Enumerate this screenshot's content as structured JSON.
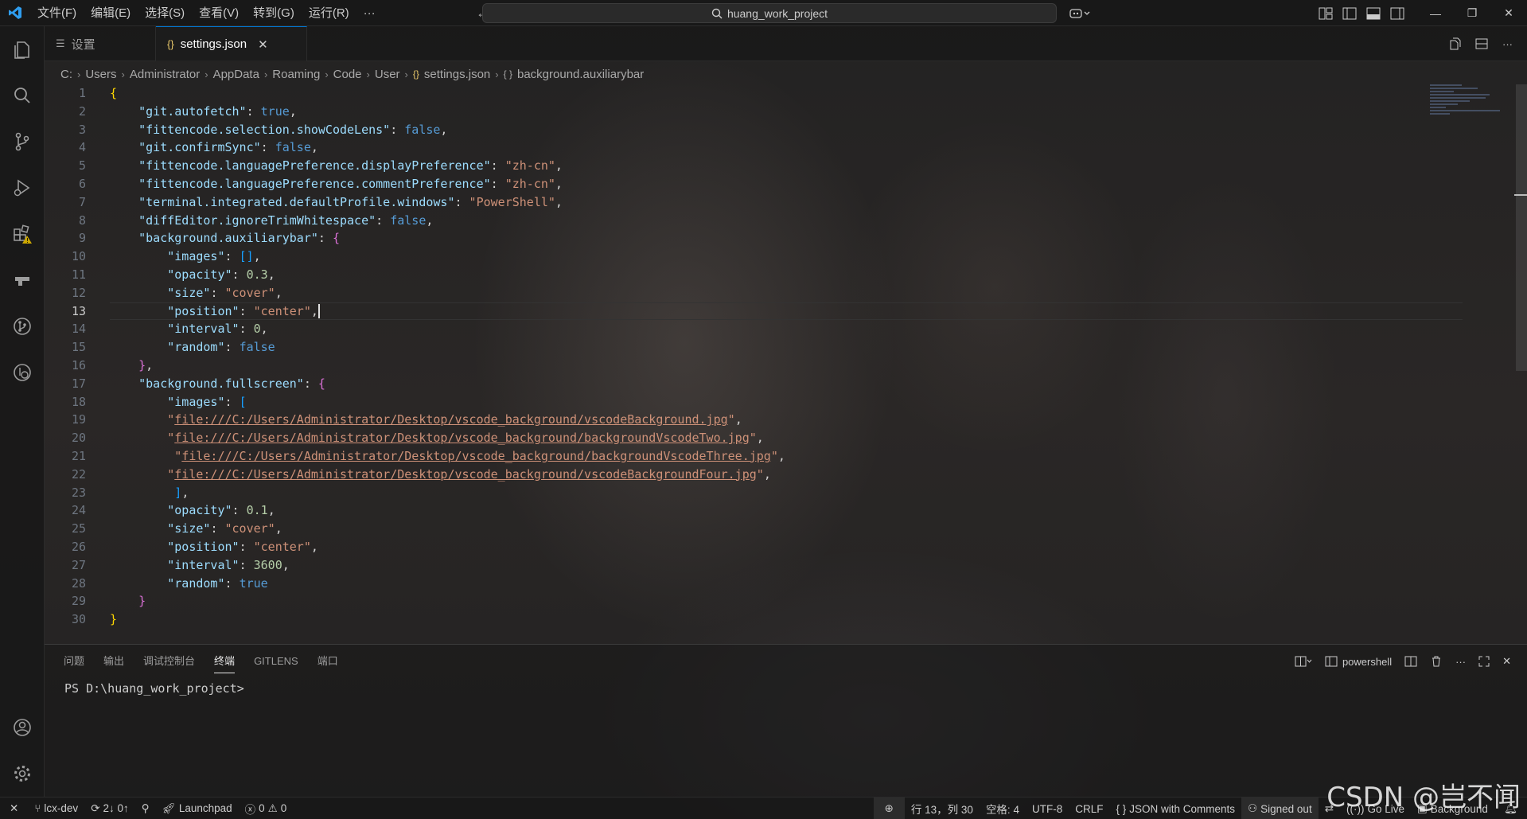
{
  "colors": {
    "accent": "#0078d4",
    "key": "#9cdcfe",
    "string": "#ce9178",
    "boolean": "#569cd6",
    "number": "#b5cea8",
    "warning": "#cca700"
  },
  "titlebar": {
    "menus": [
      "文件(F)",
      "编辑(E)",
      "选择(S)",
      "查看(V)",
      "转到(G)",
      "运行(R)",
      "···"
    ],
    "search_text": "huang_work_project"
  },
  "tabs": [
    {
      "label": "设置",
      "icon": "settings-lines-icon"
    },
    {
      "label": "settings.json",
      "icon": "json-braces-icon"
    }
  ],
  "breadcrumb": [
    "C:",
    "Users",
    "Administrator",
    "AppData",
    "Roaming",
    "Code",
    "User",
    "settings.json",
    "background.auxiliarybar"
  ],
  "editor": {
    "current_line": 13,
    "line_numbers": [
      "1",
      "2",
      "3",
      "4",
      "5",
      "6",
      "7",
      "8",
      "9",
      "10",
      "11",
      "12",
      "13",
      "14",
      "15",
      "16",
      "17",
      "18",
      "19",
      "20",
      "21",
      "22",
      "23",
      "24",
      "25",
      "26",
      "27",
      "28",
      "29",
      "30"
    ],
    "lines": [
      {
        "i": "",
        "t": [
          {
            "c": "p1",
            "v": "{"
          }
        ]
      },
      {
        "i": "    ",
        "t": [
          {
            "c": "k",
            "v": "\"git.autofetch\""
          },
          {
            "c": "",
            "v": ": "
          },
          {
            "c": "b",
            "v": "true"
          },
          {
            "c": "",
            "v": ","
          }
        ]
      },
      {
        "i": "    ",
        "t": [
          {
            "c": "k",
            "v": "\"fittencode.selection.showCodeLens\""
          },
          {
            "c": "",
            "v": ": "
          },
          {
            "c": "b",
            "v": "false"
          },
          {
            "c": "",
            "v": ","
          }
        ]
      },
      {
        "i": "    ",
        "t": [
          {
            "c": "k",
            "v": "\"git.confirmSync\""
          },
          {
            "c": "",
            "v": ": "
          },
          {
            "c": "b",
            "v": "false"
          },
          {
            "c": "",
            "v": ","
          }
        ]
      },
      {
        "i": "    ",
        "t": [
          {
            "c": "k",
            "v": "\"fittencode.languagePreference.displayPreference\""
          },
          {
            "c": "",
            "v": ": "
          },
          {
            "c": "s",
            "v": "\"zh-cn\""
          },
          {
            "c": "",
            "v": ","
          }
        ]
      },
      {
        "i": "    ",
        "t": [
          {
            "c": "k",
            "v": "\"fittencode.languagePreference.commentPreference\""
          },
          {
            "c": "",
            "v": ": "
          },
          {
            "c": "s",
            "v": "\"zh-cn\""
          },
          {
            "c": "",
            "v": ","
          }
        ]
      },
      {
        "i": "    ",
        "t": [
          {
            "c": "k",
            "v": "\"terminal.integrated.defaultProfile.windows\""
          },
          {
            "c": "",
            "v": ": "
          },
          {
            "c": "s",
            "v": "\"PowerShell\""
          },
          {
            "c": "",
            "v": ","
          }
        ]
      },
      {
        "i": "    ",
        "t": [
          {
            "c": "k",
            "v": "\"diffEditor.ignoreTrimWhitespace\""
          },
          {
            "c": "",
            "v": ": "
          },
          {
            "c": "b",
            "v": "false"
          },
          {
            "c": "",
            "v": ","
          }
        ]
      },
      {
        "i": "    ",
        "t": [
          {
            "c": "k",
            "v": "\"background.auxiliarybar\""
          },
          {
            "c": "",
            "v": ": "
          },
          {
            "c": "p2",
            "v": "{"
          }
        ]
      },
      {
        "i": "        ",
        "t": [
          {
            "c": "k",
            "v": "\"images\""
          },
          {
            "c": "",
            "v": ": "
          },
          {
            "c": "p3",
            "v": "[]"
          },
          {
            "c": "",
            "v": ","
          }
        ]
      },
      {
        "i": "        ",
        "t": [
          {
            "c": "k",
            "v": "\"opacity\""
          },
          {
            "c": "",
            "v": ": "
          },
          {
            "c": "n",
            "v": "0.3"
          },
          {
            "c": "",
            "v": ","
          }
        ]
      },
      {
        "i": "        ",
        "t": [
          {
            "c": "k",
            "v": "\"size\""
          },
          {
            "c": "",
            "v": ": "
          },
          {
            "c": "s",
            "v": "\"cover\""
          },
          {
            "c": "",
            "v": ","
          }
        ]
      },
      {
        "i": "        ",
        "t": [
          {
            "c": "k",
            "v": "\"position\""
          },
          {
            "c": "",
            "v": ": "
          },
          {
            "c": "s",
            "v": "\"center\""
          },
          {
            "c": "",
            "v": ","
          }
        ]
      },
      {
        "i": "        ",
        "t": [
          {
            "c": "k",
            "v": "\"interval\""
          },
          {
            "c": "",
            "v": ": "
          },
          {
            "c": "n",
            "v": "0"
          },
          {
            "c": "",
            "v": ","
          }
        ]
      },
      {
        "i": "        ",
        "t": [
          {
            "c": "k",
            "v": "\"random\""
          },
          {
            "c": "",
            "v": ": "
          },
          {
            "c": "b",
            "v": "false"
          }
        ]
      },
      {
        "i": "    ",
        "t": [
          {
            "c": "p2",
            "v": "}"
          },
          {
            "c": "",
            "v": ","
          }
        ]
      },
      {
        "i": "    ",
        "t": [
          {
            "c": "k",
            "v": "\"background.fullscreen\""
          },
          {
            "c": "",
            "v": ": "
          },
          {
            "c": "p2",
            "v": "{"
          }
        ]
      },
      {
        "i": "        ",
        "t": [
          {
            "c": "k",
            "v": "\"images\""
          },
          {
            "c": "",
            "v": ": "
          },
          {
            "c": "p3",
            "v": "["
          }
        ]
      },
      {
        "i": "        ",
        "t": [
          {
            "c": "s",
            "v": "\""
          },
          {
            "c": "s u",
            "v": "file:///C:/Users/Administrator/Desktop/vscode_background/vscodeBackground.jpg"
          },
          {
            "c": "s",
            "v": "\""
          },
          {
            "c": "",
            "v": ","
          }
        ]
      },
      {
        "i": "        ",
        "t": [
          {
            "c": "s",
            "v": "\""
          },
          {
            "c": "s u",
            "v": "file:///C:/Users/Administrator/Desktop/vscode_background/backgroundVscodeTwo.jpg"
          },
          {
            "c": "s",
            "v": "\""
          },
          {
            "c": "",
            "v": ","
          }
        ]
      },
      {
        "i": "         ",
        "t": [
          {
            "c": "s",
            "v": "\""
          },
          {
            "c": "s u",
            "v": "file:///C:/Users/Administrator/Desktop/vscode_background/backgroundVscodeThree.jpg"
          },
          {
            "c": "s",
            "v": "\""
          },
          {
            "c": "",
            "v": ","
          }
        ]
      },
      {
        "i": "        ",
        "t": [
          {
            "c": "s",
            "v": "\""
          },
          {
            "c": "s u",
            "v": "file:///C:/Users/Administrator/Desktop/vscode_background/vscodeBackgroundFour.jpg"
          },
          {
            "c": "s",
            "v": "\""
          },
          {
            "c": "",
            "v": ","
          }
        ]
      },
      {
        "i": "         ",
        "t": [
          {
            "c": "p3",
            "v": "]"
          },
          {
            "c": "",
            "v": ","
          }
        ]
      },
      {
        "i": "        ",
        "t": [
          {
            "c": "k",
            "v": "\"opacity\""
          },
          {
            "c": "",
            "v": ": "
          },
          {
            "c": "n",
            "v": "0.1"
          },
          {
            "c": "",
            "v": ","
          }
        ]
      },
      {
        "i": "        ",
        "t": [
          {
            "c": "k",
            "v": "\"size\""
          },
          {
            "c": "",
            "v": ": "
          },
          {
            "c": "s",
            "v": "\"cover\""
          },
          {
            "c": "",
            "v": ","
          }
        ]
      },
      {
        "i": "        ",
        "t": [
          {
            "c": "k",
            "v": "\"position\""
          },
          {
            "c": "",
            "v": ": "
          },
          {
            "c": "s",
            "v": "\"center\""
          },
          {
            "c": "",
            "v": ","
          }
        ]
      },
      {
        "i": "        ",
        "t": [
          {
            "c": "k",
            "v": "\"interval\""
          },
          {
            "c": "",
            "v": ": "
          },
          {
            "c": "n",
            "v": "3600"
          },
          {
            "c": "",
            "v": ","
          }
        ]
      },
      {
        "i": "        ",
        "t": [
          {
            "c": "k",
            "v": "\"random\""
          },
          {
            "c": "",
            "v": ": "
          },
          {
            "c": "b",
            "v": "true"
          }
        ]
      },
      {
        "i": "    ",
        "t": [
          {
            "c": "p2",
            "v": "}"
          }
        ]
      },
      {
        "i": "",
        "t": [
          {
            "c": "p1",
            "v": "}"
          }
        ]
      }
    ]
  },
  "panel": {
    "tabs": [
      "问题",
      "输出",
      "调试控制台",
      "终端",
      "GITLENS",
      "端口"
    ],
    "active_tab": "终端",
    "terminal_name": "powershell",
    "prompt": "PS D:\\huang_work_project>"
  },
  "statusbar": {
    "remote": "✕",
    "branch": "lcx-dev",
    "sync": "2↓ 0↑",
    "launchpad": "Launchpad",
    "errors": "0",
    "warnings": "0",
    "cursor": "行 13，列 30",
    "spaces": "空格: 4",
    "encoding": "UTF-8",
    "eol": "CRLF",
    "language": "JSON with Comments",
    "account": "Signed out",
    "golive": "Go Live",
    "background": "Background"
  },
  "watermark": "CSDN @岂不闻"
}
